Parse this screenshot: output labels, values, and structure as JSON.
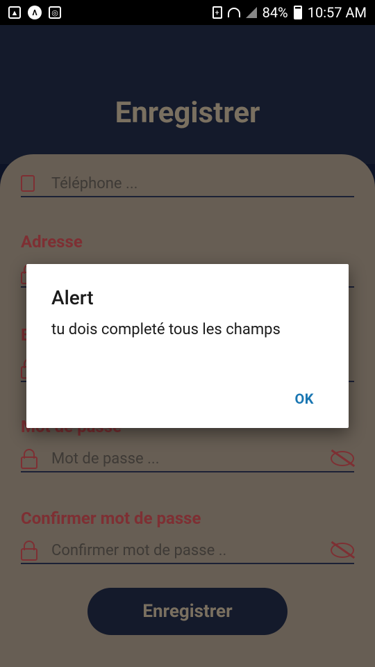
{
  "status_bar": {
    "battery": "84%",
    "time": "10:57 AM"
  },
  "page": {
    "title": "Enregistrer"
  },
  "form": {
    "telephone_placeholder": "Téléphone ...",
    "address_label": "Adresse",
    "email_label_partial": "E",
    "password_label": "Mot de passe",
    "password_placeholder": "Mot de passe ...",
    "confirm_label": "Confirmer mot de passe",
    "confirm_placeholder": "Confirmer mot de passe ..",
    "submit_label": "Enregistrer"
  },
  "alert": {
    "title": "Alert",
    "message": "tu dois completé tous les champs",
    "ok_label": "OK"
  },
  "colors": {
    "header_bg": "#141a2b",
    "card_bg": "#675e54",
    "accent": "#7e2f33",
    "dialog_button": "#1976b2"
  }
}
